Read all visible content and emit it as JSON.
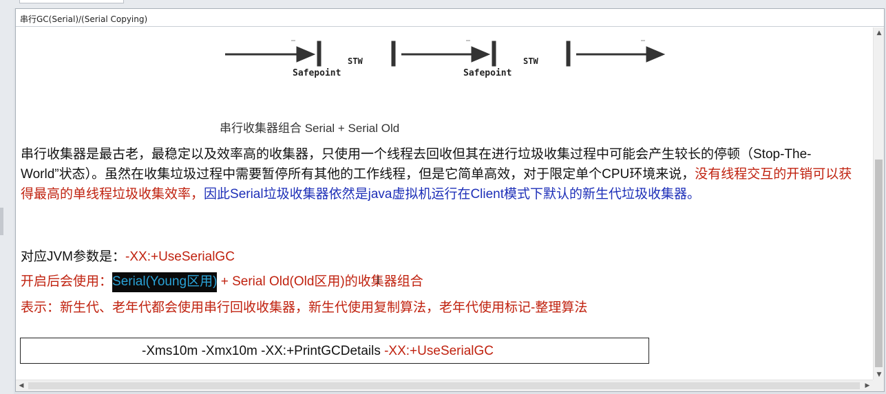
{
  "window": {
    "title": "串行GC(Serial)/(Serial Copying)"
  },
  "diagram": {
    "stw_label": "STW",
    "safepoint_label": "Safepoint",
    "caption": "串行收集器组合 Serial + Serial Old"
  },
  "description": {
    "black_part": "串行收集器是最古老，最稳定以及效率高的收集器，只使用一个线程去回收但其在进行垃圾收集过程中可能会产生较长的停顿（Stop-The-World”状态）。虽然在收集垃圾过程中需要暂停所有其他的工作线程，但是它简单高效，对于限定单个CPU环境来说，",
    "red_part": "没有线程交互的开销可以获得最高的单线程垃圾收集效率，",
    "blue_part": "因此Serial垃圾收集器依然是java虚拟机运行在Client模式下默认的新生代垃圾收集器。"
  },
  "jvm_param": {
    "label": "对应JVM参数是：",
    "value": "-XX:+UseSerialGC"
  },
  "usage": {
    "prefix": "开启后会使用：",
    "highlight": "Serial(Young区用)",
    "suffix": " + Serial Old(Old区用)的收集器组合"
  },
  "meaning": {
    "text": "表示：新生代、老年代都会使用串行回收收集器，新生代使用复制算法，老年代使用标记-整理算法"
  },
  "command": {
    "base": "-Xms10m -Xmx10m -XX:+PrintGCDetails ",
    "flag": "-XX:+UseSerialGC"
  },
  "icons": {
    "scroll_up": "triangle-up-icon",
    "scroll_down": "triangle-down-icon",
    "scroll_left": "triangle-left-icon",
    "scroll_right": "triangle-right-icon"
  },
  "colors": {
    "red_text": "#c0220f",
    "blue_text": "#1d2fb8",
    "highlight_bg": "#0a0a0a",
    "highlight_fg": "#2aa2d6"
  }
}
